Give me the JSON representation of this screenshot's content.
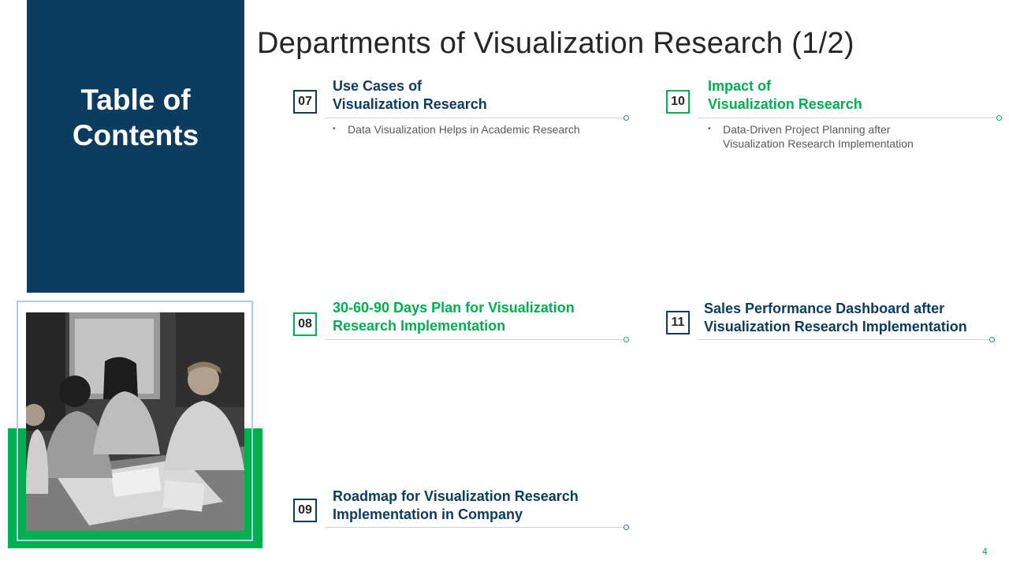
{
  "slide": {
    "title": "Departments of Visualization Research (1/2)",
    "page_number": "4"
  },
  "toc": {
    "heading_line1": "Table of",
    "heading_line2": "Contents"
  },
  "items": [
    {
      "number": "07",
      "title_line1": "Use Cases of",
      "title_line2": "Visualization Research",
      "bullets": [
        "Data Visualization Helps in Academic Research"
      ]
    },
    {
      "number": "08",
      "title_line1": "30-60-90 Days Plan for Visualization",
      "title_line2": "Research Implementation",
      "bullets": []
    },
    {
      "number": "09",
      "title_line1": "Roadmap for Visualization Research",
      "title_line2": "Implementation in Company",
      "bullets": []
    },
    {
      "number": "10",
      "title_line1": "Impact of",
      "title_line2": "Visualization Research",
      "bullets": [
        "Data-Driven Project Planning after",
        "Visualization Research Implementation"
      ]
    },
    {
      "number": "11",
      "title_line1": "Sales Performance Dashboard after",
      "title_line2": "Visualization Research Implementation",
      "bullets": []
    }
  ],
  "colors": {
    "navy": "#0d3c61",
    "green": "#00b050",
    "frame": "#a9cfe0"
  }
}
